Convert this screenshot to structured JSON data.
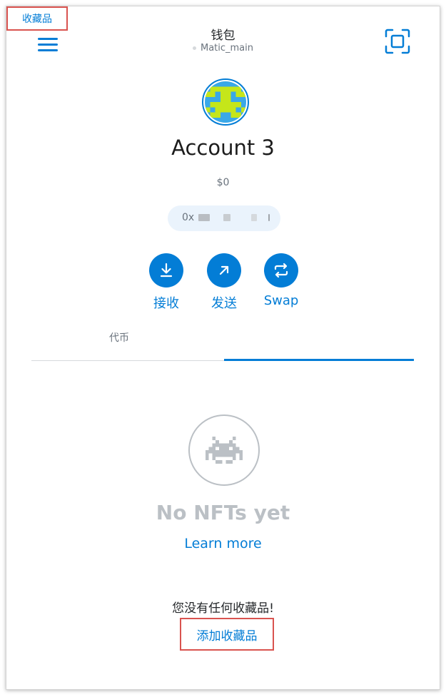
{
  "header": {
    "title": "钱包",
    "network": "Matic_main"
  },
  "account": {
    "name": "Account 3",
    "balance": "$0",
    "address_prefix": "0x"
  },
  "actions": [
    {
      "label": "接收",
      "icon": "receive-icon"
    },
    {
      "label": "发送",
      "icon": "send-icon"
    },
    {
      "label": "Swap",
      "icon": "swap-icon"
    }
  ],
  "tabs": {
    "tokens": "代币",
    "collectibles": "收藏品",
    "active": "collectibles"
  },
  "empty_state": {
    "heading": "No NFTs yet",
    "learn_more": "Learn more",
    "message": "您没有任何收藏品!",
    "add_link": "添加收藏品"
  },
  "colors": {
    "accent": "#037dd6",
    "highlight_box": "#d9534f",
    "muted": "#bbc0c5",
    "avatar_green": "#c5e61a",
    "avatar_blue": "#3aa8e8"
  }
}
